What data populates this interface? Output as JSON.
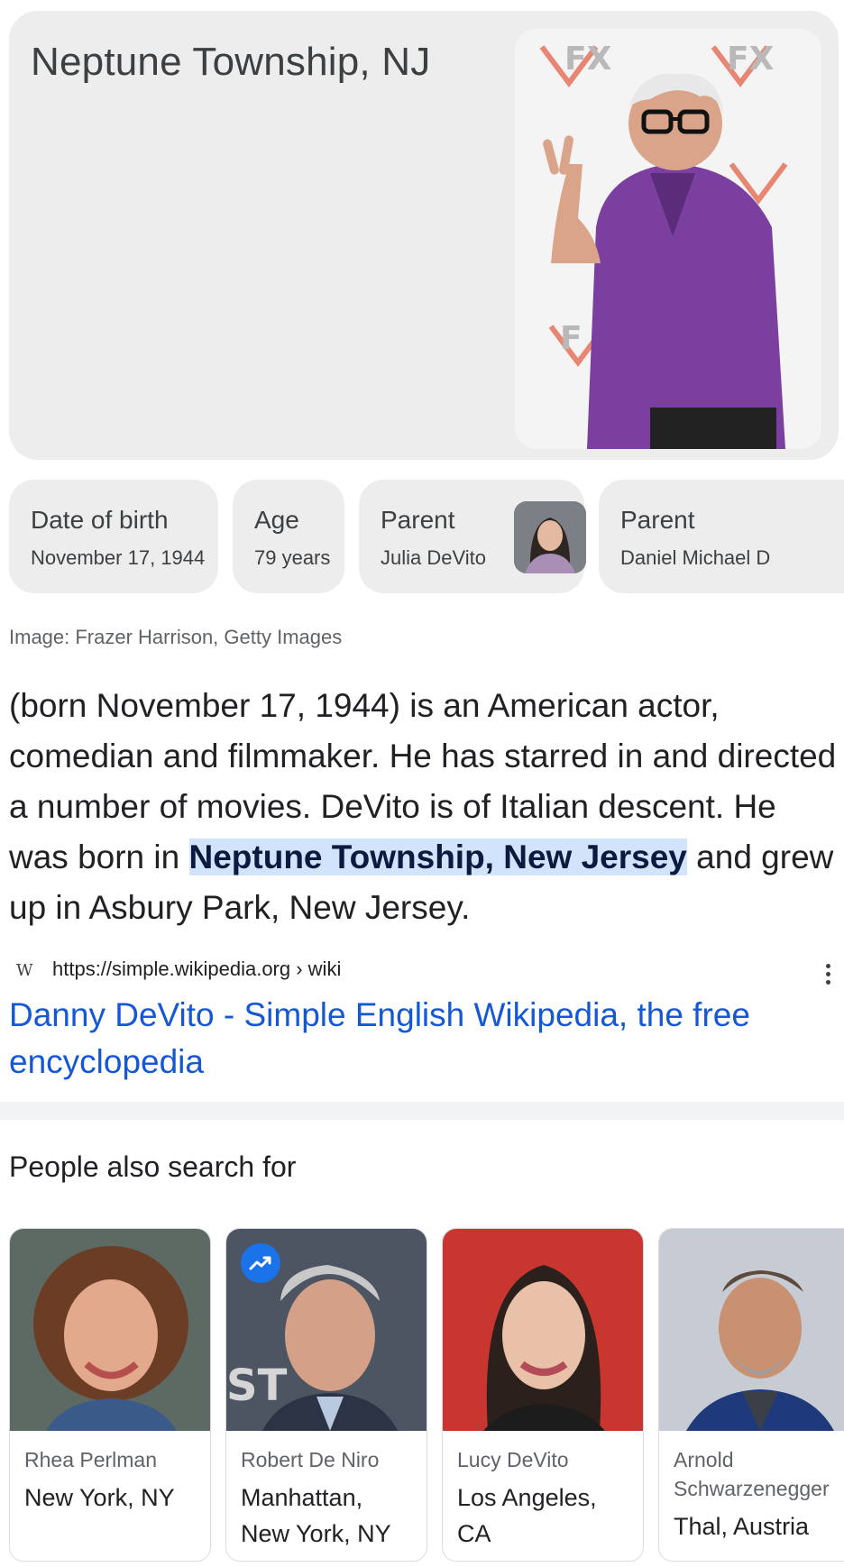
{
  "hero": {
    "title": "Neptune Township, NJ",
    "photo_icon": "person-photo"
  },
  "facts": [
    {
      "label": "Date of birth",
      "value": "November 17, 1944"
    },
    {
      "label": "Age",
      "value": "79 years"
    },
    {
      "label": "Parent",
      "value": "Julia DeVito",
      "thumb_icon": "person-thumbnail"
    },
    {
      "label": "Parent",
      "value": "Daniel Michael D"
    }
  ],
  "image_credit": "Image: Frazer Harrison, Getty Images",
  "description": {
    "before": "(born November 17, 1944) is an American actor, comedian and filmmaker. He has starred in and directed a number of movies. DeVito is of Italian descent. He was born in ",
    "highlight": "Neptune Township, New Jersey",
    "after": " and grew up in Asbury Park, New Jersey."
  },
  "source": {
    "favicon": "W",
    "url": "https://simple.wikipedia.org › wiki",
    "more_icon": "more-vert-icon"
  },
  "result_link": "Danny DeVito - Simple English Wikipedia, the free encyclopedia",
  "people_also_search": {
    "title": "People also search for",
    "cards": [
      {
        "name": "Rhea Perlman",
        "place": "New York, NY"
      },
      {
        "name": "Robert De Niro",
        "place": "Manhattan, New York, NY",
        "trending_icon": "trending-up-icon"
      },
      {
        "name": "Lucy DeVito",
        "place": "Los Angeles, CA"
      },
      {
        "name": "Arnold Schwarzenegger",
        "place": "Thal, Austria"
      }
    ]
  },
  "colors": {
    "card_bg": "#ededed",
    "link": "#1558d6",
    "highlight": "#d2e3fc",
    "trend_badge": "#1a73e8"
  }
}
